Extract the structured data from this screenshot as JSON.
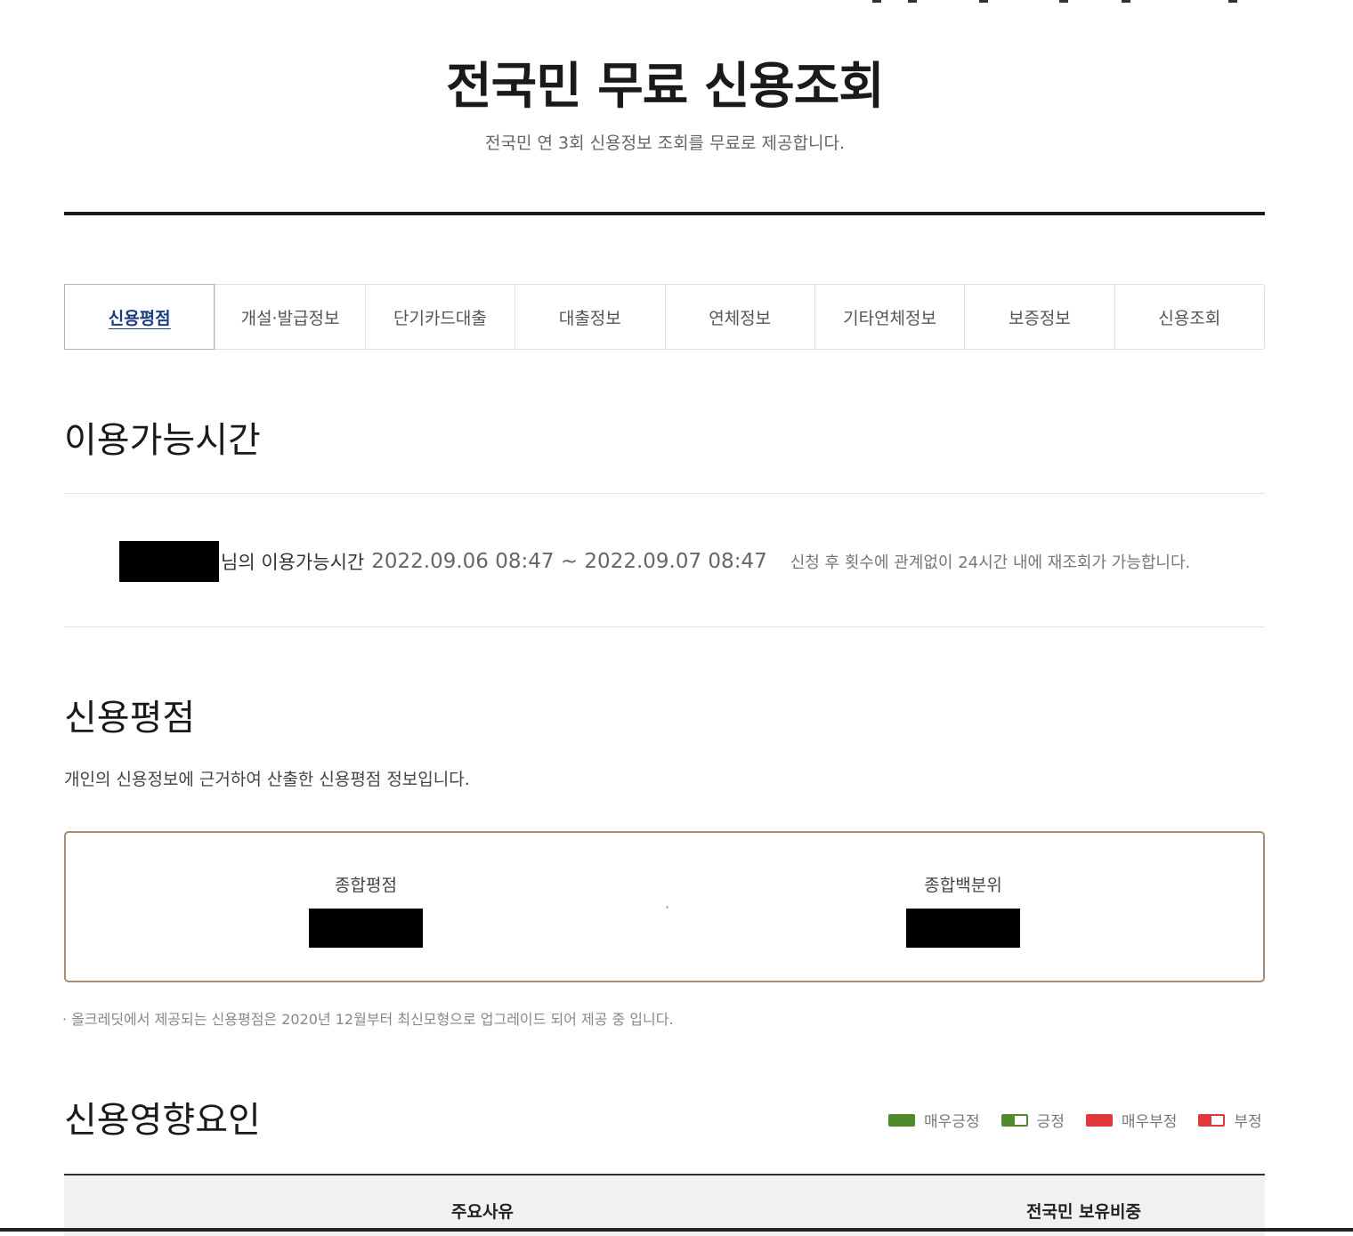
{
  "header": {
    "title": "전국민 무료 신용조회",
    "subtitle": "전국민 연 3회 신용정보 조회를 무료로 제공합니다."
  },
  "tabs": [
    {
      "label": "신용평점",
      "active": true
    },
    {
      "label": "개설·발급정보",
      "active": false
    },
    {
      "label": "단기카드대출",
      "active": false
    },
    {
      "label": "대출정보",
      "active": false
    },
    {
      "label": "연체정보",
      "active": false
    },
    {
      "label": "기타연체정보",
      "active": false
    },
    {
      "label": "보증정보",
      "active": false
    },
    {
      "label": "신용조회",
      "active": false
    }
  ],
  "availability": {
    "title": "이용가능시간",
    "label": "님의 이용가능시간",
    "time_range": "2022.09.06 08:47 ~ 2022.09.07 08:47",
    "note": "신청 후 횟수에 관계없이 24시간 내에 재조회가 가능합니다."
  },
  "credit_score": {
    "title": "신용평점",
    "description": "개인의 신용정보에 근거하여 산출한 신용평점 정보입니다.",
    "total_score_label": "종합평점",
    "total_percentile_label": "종합백분위",
    "note": "· 올크레딧에서 제공되는 신용평점은 2020년 12월부터 최신모형으로 업그레이드 되어 제공 중 입니다."
  },
  "factors": {
    "title": "신용영향요인",
    "legend": [
      {
        "label": "매우긍정",
        "color": "#4f8a2c",
        "style": "full"
      },
      {
        "label": "긍정",
        "color": "#4f8a2c",
        "style": "half"
      },
      {
        "label": "매우부정",
        "color": "#e0383b",
        "style": "full"
      },
      {
        "label": "부정",
        "color": "#e0383b",
        "style": "half"
      }
    ],
    "table_headers": [
      "주요사유",
      "전국민 보유비중"
    ]
  }
}
